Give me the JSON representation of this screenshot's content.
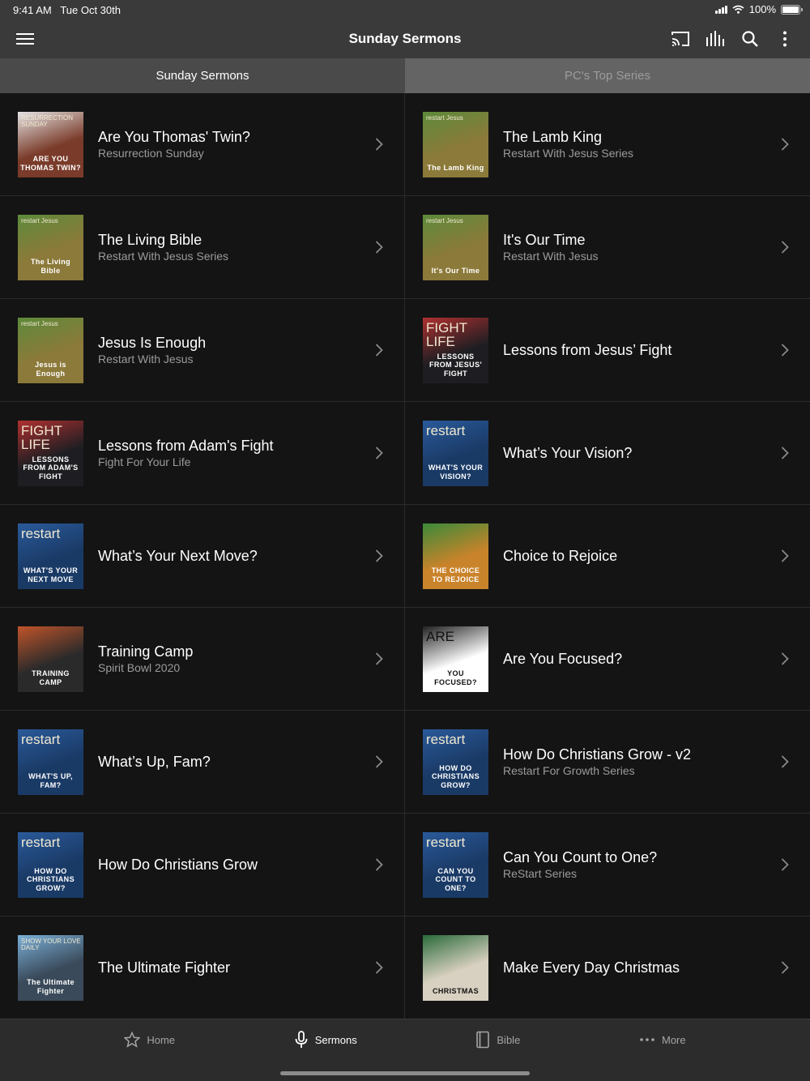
{
  "status": {
    "time": "9:41 AM",
    "date": "Tue Oct 30th",
    "battery": "100%",
    "battery_level": 1.0
  },
  "nav": {
    "title": "Sunday Sermons"
  },
  "tabs": [
    {
      "label": "Sunday Sermons",
      "selected": true
    },
    {
      "label": "PC's Top Series",
      "selected": false
    }
  ],
  "items": [
    {
      "title": "Are You Thomas' Twin?",
      "subtitle": "Resurrection Sunday",
      "thumb": {
        "top": "RESURRECTION SUNDAY",
        "text": "ARE YOU THOMAS TWIN?",
        "bg": "#7a3b2a",
        "accent": "#e5e5e5"
      }
    },
    {
      "title": "The Lamb King",
      "subtitle": "Restart With Jesus Series",
      "thumb": {
        "top": "restart Jesus",
        "text": "The Lamb King",
        "bg": "#8c7a3a",
        "accent": "#5c8a3a"
      }
    },
    {
      "title": "The Living Bible",
      "subtitle": "Restart With Jesus Series",
      "thumb": {
        "top": "restart Jesus",
        "text": "The Living Bible",
        "bg": "#8c7a3a",
        "accent": "#5c8a3a"
      }
    },
    {
      "title": "It's Our Time",
      "subtitle": "Restart With Jesus",
      "thumb": {
        "top": "restart Jesus",
        "text": "It's Our Time",
        "bg": "#8c7a3a",
        "accent": "#5c8a3a"
      }
    },
    {
      "title": "Jesus Is Enough",
      "subtitle": "Restart With Jesus",
      "thumb": {
        "top": "restart Jesus",
        "text": "Jesus is Enough",
        "bg": "#8c7a3a",
        "accent": "#5c8a3a"
      }
    },
    {
      "title": "Lessons from Jesus’ Fight",
      "subtitle": "",
      "thumb": {
        "top": "FIGHT LIFE",
        "text": "LESSONS FROM JESUS' FIGHT",
        "bg": "#1e1e22",
        "accent": "#b03030"
      }
    },
    {
      "title": "Lessons from Adam's Fight",
      "subtitle": "Fight For Your Life",
      "thumb": {
        "top": "FIGHT LIFE",
        "text": "LESSONS FROM ADAM'S FIGHT",
        "bg": "#1e1e22",
        "accent": "#b03030"
      }
    },
    {
      "title": "What’s Your Vision?",
      "subtitle": "",
      "thumb": {
        "top": "restart",
        "text": "WHAT'S YOUR VISION?",
        "bg": "#1a3a66",
        "accent": "#2a5a9a"
      }
    },
    {
      "title": "What’s Your Next Move?",
      "subtitle": "",
      "thumb": {
        "top": "restart",
        "text": "WHAT'S YOUR NEXT MOVE",
        "bg": "#1a3a66",
        "accent": "#2a5a9a"
      }
    },
    {
      "title": "Choice to Rejoice",
      "subtitle": "",
      "thumb": {
        "top": "",
        "text": "THE CHOICE TO REJOICE",
        "bg": "#c9832a",
        "accent": "#3a8a3a"
      }
    },
    {
      "title": "Training Camp",
      "subtitle": "Spirit Bowl 2020",
      "thumb": {
        "top": "",
        "text": "TRAINING CAMP",
        "bg": "#2a2a2a",
        "accent": "#c0542a"
      }
    },
    {
      "title": "Are You Focused?",
      "subtitle": "",
      "thumb": {
        "top": "ARE",
        "text": "YOU FOCUSED?",
        "bg": "#ffffff",
        "accent": "#222222"
      }
    },
    {
      "title": "What’s Up, Fam?",
      "subtitle": "",
      "thumb": {
        "top": "restart",
        "text": "WHAT'S UP, FAM?",
        "bg": "#1a3a66",
        "accent": "#2a5a9a"
      }
    },
    {
      "title": "How Do Christians Grow - v2",
      "subtitle": "Restart For Growth Series",
      "thumb": {
        "top": "restart",
        "text": "HOW DO CHRISTIANS GROW?",
        "bg": "#1a3a66",
        "accent": "#2a5a9a"
      }
    },
    {
      "title": "How Do Christians Grow",
      "subtitle": "",
      "thumb": {
        "top": "restart",
        "text": "HOW DO CHRISTIANS GROW?",
        "bg": "#1a3a66",
        "accent": "#2a5a9a"
      }
    },
    {
      "title": "Can You Count to One?",
      "subtitle": "ReStart Series",
      "thumb": {
        "top": "restart",
        "text": "CAN YOU COUNT TO ONE?",
        "bg": "#1a3a66",
        "accent": "#2a5a9a"
      }
    },
    {
      "title": "The Ultimate Fighter",
      "subtitle": "",
      "thumb": {
        "top": "SHOW YOUR LOVE DAILY",
        "text": "The Ultimate Fighter",
        "bg": "#3a4a5a",
        "accent": "#7ab0d8"
      }
    },
    {
      "title": "Make Every Day Christmas",
      "subtitle": "",
      "thumb": {
        "top": "",
        "text": "CHRISTMAS",
        "bg": "#d8d0c0",
        "accent": "#2a6a3a"
      }
    }
  ],
  "bottom_nav": [
    {
      "label": "Home",
      "icon": "star-icon",
      "active": false
    },
    {
      "label": "Sermons",
      "icon": "microphone-icon",
      "active": true
    },
    {
      "label": "Bible",
      "icon": "book-icon",
      "active": false
    },
    {
      "label": "More",
      "icon": "more-dots-icon",
      "active": false
    }
  ]
}
